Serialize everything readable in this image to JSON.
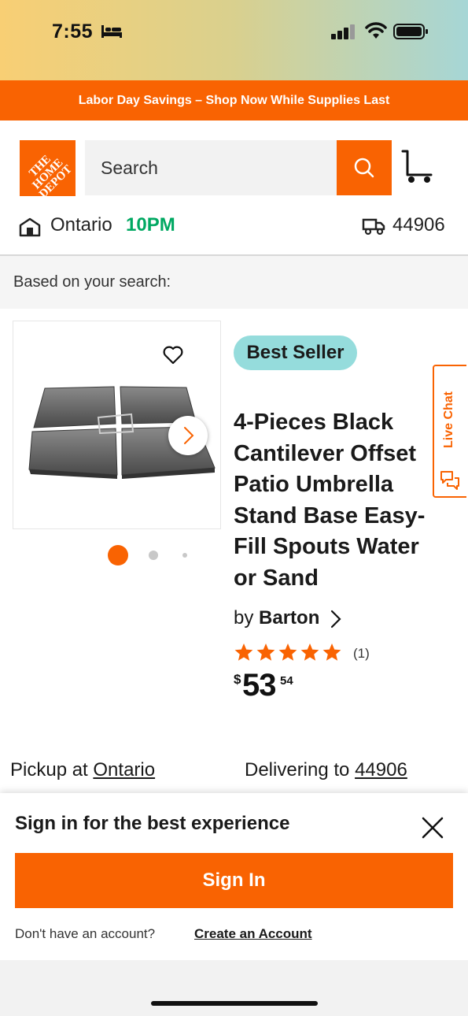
{
  "status_bar": {
    "time": "7:55"
  },
  "promo": {
    "text": "Labor Day Savings – Shop Now While Supplies Last"
  },
  "header": {
    "logo_text": "THE HOME DEPOT",
    "search_placeholder": "Search",
    "store_name": "Ontario",
    "store_hours": "10PM",
    "zip": "44906"
  },
  "section_label": "Based on your search:",
  "product": {
    "badge": "Best Seller",
    "title": "4-Pieces Black Cantilever Offset Patio Umbrella Stand Base Easy-Fill Spouts Water or Sand",
    "by_prefix": "by",
    "brand": "Barton",
    "rating": 5,
    "review_count": "(1)",
    "currency": "$",
    "price_dollars": "53",
    "price_cents": "54",
    "image_count": 3,
    "current_image": 1
  },
  "live_chat": {
    "label": "Live Chat"
  },
  "fulfillment": {
    "pickup_prefix": "Pickup at",
    "pickup_store": "Ontario",
    "delivery_prefix": "Delivering to",
    "delivery_zip": "44906"
  },
  "sign_in_sheet": {
    "title": "Sign in for the best experience",
    "button": "Sign In",
    "no_account": "Don't have an account?",
    "create_link": "Create an Account"
  },
  "colors": {
    "brand": "#f96302",
    "badge": "#95dcdc",
    "open_hours": "#00a862"
  }
}
